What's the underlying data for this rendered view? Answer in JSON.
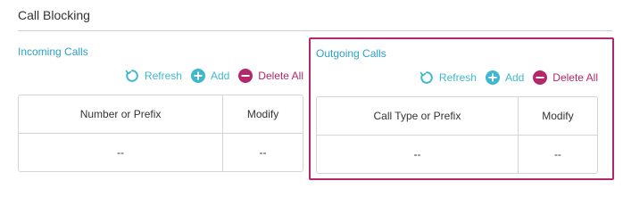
{
  "section": {
    "title": "Call Blocking"
  },
  "incoming": {
    "title": "Incoming Calls",
    "toolbar": {
      "refresh": "Refresh",
      "add": "Add",
      "delete_all": "Delete All"
    },
    "columns": [
      "Number or Prefix",
      "Modify"
    ],
    "rows": [
      [
        "--",
        "--"
      ]
    ]
  },
  "outgoing": {
    "title": "Outgoing Calls",
    "toolbar": {
      "refresh": "Refresh",
      "add": "Add",
      "delete_all": "Delete All"
    },
    "columns": [
      "Call Type or Prefix",
      "Modify"
    ],
    "rows": [
      [
        "--",
        "--"
      ]
    ]
  },
  "icons": {
    "refresh": "refresh-icon",
    "add": "plus-circle-icon",
    "delete": "minus-circle-icon"
  },
  "colors": {
    "accent": "#3fb8cf",
    "title_link": "#2ca0c5",
    "danger": "#b5276c",
    "highlight_border": "#b5276c"
  }
}
